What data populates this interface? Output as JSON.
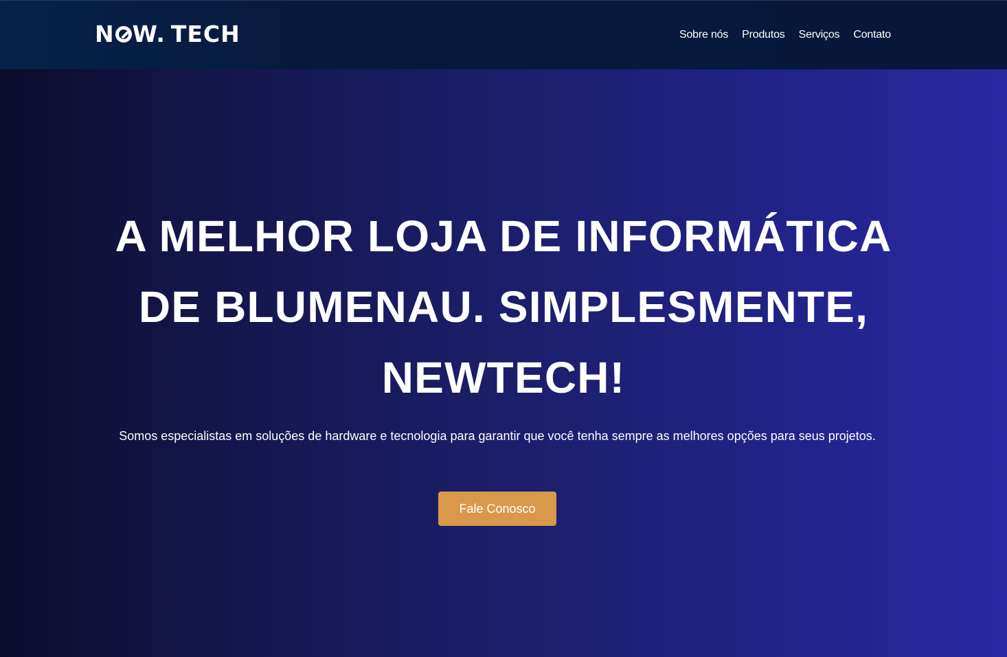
{
  "header": {
    "logo": {
      "part1": "N",
      "part2": "W.",
      "part3": "TECH",
      "icon": "circle-slash-o-icon"
    },
    "nav": [
      {
        "label": "Sobre nós"
      },
      {
        "label": "Produtos"
      },
      {
        "label": "Serviços"
      },
      {
        "label": "Contato"
      }
    ]
  },
  "hero": {
    "title": "A MELHOR LOJA DE INFORMÁTICA DE BLUMENAU. SIMPLESMENTE, NEWTECH!",
    "subtitle": "Somos especialistas em soluções de hardware e tecnologia para garantir que você tenha sempre as melhores opções para seus projetos.",
    "cta_label": "Fale Conosco"
  },
  "colors": {
    "header_bg": "#071a3e",
    "hero_gradient_start": "#0b0c2b",
    "hero_gradient_end": "#2b29a3",
    "cta_bg": "#d9984a",
    "text": "#ffffff"
  }
}
